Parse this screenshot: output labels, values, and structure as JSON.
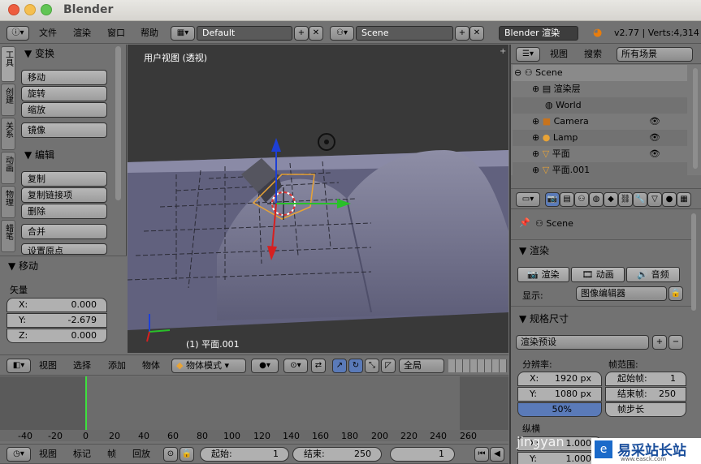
{
  "window": {
    "title": "Blender"
  },
  "info_header": {
    "menus": [
      "文件",
      "渲染",
      "窗口",
      "帮助"
    ],
    "screen": "Default",
    "scene": "Scene",
    "engine": "Blender 渲染",
    "stats": "v2.77 | Verts:4,314"
  },
  "toolshelf": {
    "tabs": [
      "工具",
      "创建",
      "关系",
      "动画",
      "物理",
      "蜡笔"
    ],
    "transform_header": "▼ 变换",
    "transform_buttons": [
      "移动",
      "旋转",
      "缩放",
      "镜像"
    ],
    "edit_header": "▼ 编辑",
    "edit_buttons": [
      "复制",
      "复制链接项",
      "删除",
      "合并",
      "设置原点"
    ],
    "operator_header": "▼ 移动",
    "vector_label": "矢量",
    "vector": [
      {
        "axis": "X:",
        "value": "0.000"
      },
      {
        "axis": "Y:",
        "value": "-2.679"
      },
      {
        "axis": "Z:",
        "value": "0.000"
      }
    ]
  },
  "viewport": {
    "label": "用户视图 (透视)",
    "object_label": "(1) 平面.001"
  },
  "view3d_header": {
    "menus": [
      "视图",
      "选择",
      "添加",
      "物体"
    ],
    "mode": "物体模式",
    "orientation": "全局"
  },
  "timeline": {
    "ticks": [
      "-40",
      "-20",
      "0",
      "20",
      "40",
      "60",
      "80",
      "100",
      "120",
      "140",
      "160",
      "180",
      "200",
      "220",
      "240",
      "260"
    ],
    "menus": [
      "视图",
      "标记",
      "帧",
      "回放"
    ],
    "start_label": "起始:",
    "start_value": "1",
    "end_label": "结束:",
    "end_value": "250",
    "current": "1"
  },
  "outliner": {
    "menus": [
      "视图",
      "搜索"
    ],
    "filter": "所有场景",
    "items": [
      {
        "label": "Scene"
      },
      {
        "label": "渲染层"
      },
      {
        "label": "World"
      },
      {
        "label": "Camera"
      },
      {
        "label": "Lamp"
      },
      {
        "label": "平面"
      },
      {
        "label": "平面.001"
      }
    ]
  },
  "properties": {
    "context": "Scene",
    "render_header": "▼ 渲染",
    "render_buttons": [
      "渲染",
      "动画",
      "音频"
    ],
    "display_label": "显示:",
    "display_value": "图像编辑器",
    "dimensions_header": "▼ 规格尺寸",
    "preset": "渲染预设",
    "resolution_label": "分辨率:",
    "frame_range_label": "帧范围:",
    "res_x": {
      "k": "X:",
      "v": "1920 px"
    },
    "res_y": {
      "k": "Y:",
      "v": "1080 px"
    },
    "res_pct": "50%",
    "start_frame": {
      "k": "起始帧:",
      "v": "1"
    },
    "end_frame": {
      "k": "结束帧:",
      "v": "250"
    },
    "step": "帧步长",
    "aspect_label": "纵横",
    "asp_x": {
      "k": "X:",
      "v": "1.000"
    },
    "asp_y": {
      "k": "Y:",
      "v": "1.000"
    }
  },
  "watermark": {
    "text": "jingyan",
    "site": "易采站长站",
    "url": "www.easck.com"
  }
}
